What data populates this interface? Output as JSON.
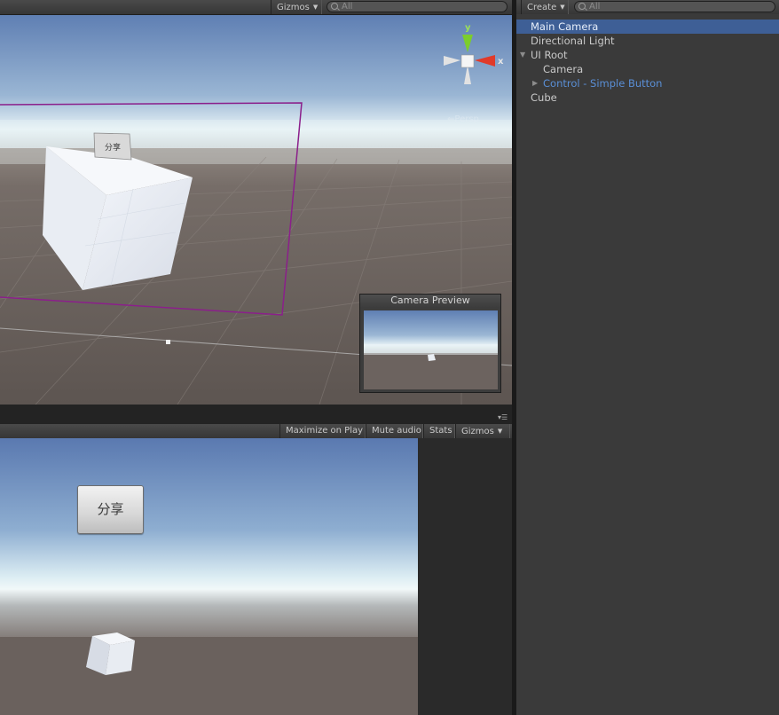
{
  "scene_view": {
    "toolbar": {
      "gizmos_label": "Gizmos",
      "search_placeholder": "All"
    },
    "gizmo": {
      "y_label": "y",
      "x_label": "x",
      "projection_label": "Persp"
    },
    "world_button_label": "分享",
    "camera_preview": {
      "title": "Camera Preview"
    }
  },
  "game_view": {
    "toolbar": {
      "maximize_label": "Maximize on Play",
      "mute_label": "Mute audio",
      "stats_label": "Stats",
      "gizmos_label": "Gizmos"
    },
    "ui_button_label": "分享"
  },
  "hierarchy": {
    "toolbar": {
      "create_label": "Create",
      "search_placeholder": "All"
    },
    "items": [
      {
        "label": "Main Camera",
        "selected": true
      },
      {
        "label": "Directional Light"
      },
      {
        "label": "UI Root",
        "expanded": true
      },
      {
        "label": "Camera"
      },
      {
        "label": "Control - Simple Button",
        "prefab": true
      },
      {
        "label": "Cube"
      }
    ]
  },
  "colors": {
    "selection": "#3e5f96",
    "prefab_text": "#5a8fd6",
    "gizmo_x": "#e03a2a",
    "gizmo_y": "#7ccd2c",
    "ui_bounds": "#8b1f8b"
  }
}
